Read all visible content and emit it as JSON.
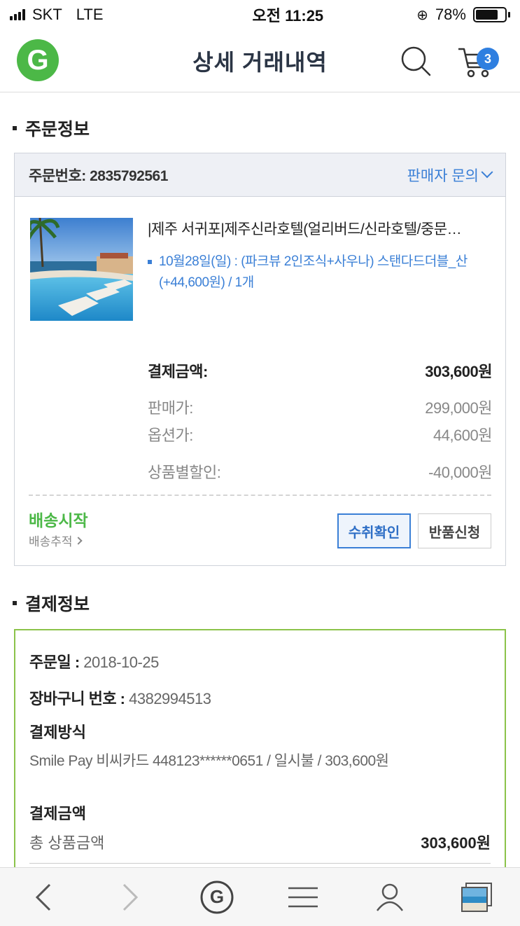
{
  "status_bar": {
    "carrier": "SKT",
    "network": "LTE",
    "time": "오전 11:25",
    "battery": "78%",
    "battery_level": 0.78
  },
  "header": {
    "logo": "G",
    "title": "상세 거래내역",
    "cart_count": "3",
    "icons": {
      "search": "search-icon",
      "cart": "cart-icon"
    }
  },
  "order_section": {
    "title": "주문정보",
    "order_number": "주문번호: 2835792561",
    "seller_inquiry": "판매자 문의",
    "product": {
      "title": "|제주 서귀포|제주신라호텔(얼리버드/신라호텔/중문…",
      "option": "10월28일(일) : (파크뷰 2인조식+사우나) 스탠다드더블_산 (+44,600원) / 1개"
    },
    "prices": {
      "total_label": "결제금액:",
      "total_value": "303,600원",
      "sale_label": "판매가:",
      "sale_value": "299,000원",
      "option_label": "옵션가:",
      "option_value": "44,600원",
      "discount_label": "상품별할인:",
      "discount_value": "-40,000원"
    },
    "shipping_status": "배송시작",
    "shipping_track": "배송추적",
    "receive_button": "수취확인",
    "return_button": "반품신청"
  },
  "payment_section": {
    "title": "결제정보",
    "order_date_label": "주문일 : ",
    "order_date": "2018-10-25",
    "cart_no_label": "장바구니 번호 : ",
    "cart_no": "4382994513",
    "method_label": "결제방식",
    "method_value": "Smile Pay 비씨카드 448123******0651 / 일시불 / 303,600원",
    "amount_label": "결제금액",
    "total_product_label": "총 상품금액",
    "total_product_value": "303,600원"
  },
  "colors": {
    "accent_blue": "#3a7fd6",
    "brand_green": "#4cb847",
    "payment_border": "#8bc34a"
  },
  "bottom_nav": {
    "icons": [
      "back-icon",
      "forward-icon",
      "home-g-icon",
      "menu-icon",
      "profile-icon",
      "tabs-icon"
    ]
  }
}
